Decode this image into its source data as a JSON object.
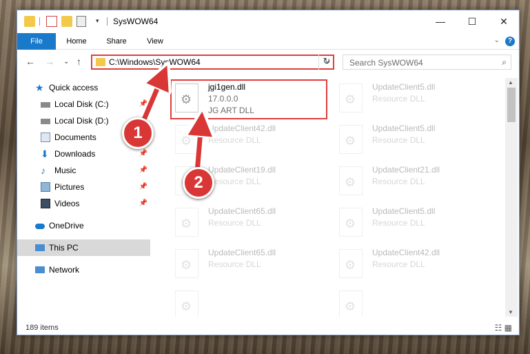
{
  "window": {
    "title": "SysWOW64",
    "controls": {
      "minimize": "—",
      "maximize": "☐",
      "close": "✕"
    }
  },
  "ribbon": {
    "tabs": [
      "File",
      "Home",
      "Share",
      "View"
    ],
    "help": "?",
    "expand": "⌄"
  },
  "nav": {
    "back": "←",
    "forward": "→",
    "recent": "⌄",
    "up": "↑",
    "address": "C:\\Windows\\SysWOW64",
    "refresh": "↻",
    "search_placeholder": "Search SysWOW64"
  },
  "sidebar": {
    "items": [
      {
        "label": "Quick access",
        "icon": "star-icon",
        "pinned": false
      },
      {
        "label": "Local Disk (C:)",
        "icon": "drive-icon",
        "pinned": true
      },
      {
        "label": "Local Disk (D:)",
        "icon": "drive-icon",
        "pinned": true
      },
      {
        "label": "Documents",
        "icon": "documents-icon",
        "pinned": true
      },
      {
        "label": "Downloads",
        "icon": "download-icon",
        "pinned": true
      },
      {
        "label": "Music",
        "icon": "music-icon",
        "pinned": true
      },
      {
        "label": "Pictures",
        "icon": "pictures-icon",
        "pinned": true
      },
      {
        "label": "Videos",
        "icon": "videos-icon",
        "pinned": true
      },
      {
        "label": "OneDrive",
        "icon": "cloud-icon",
        "pinned": false
      },
      {
        "label": "This PC",
        "icon": "computer-icon",
        "pinned": false
      },
      {
        "label": "Network",
        "icon": "network-icon",
        "pinned": false
      }
    ]
  },
  "files": [
    {
      "name": "jgi1gen.dll",
      "line2": "17.0.0.0",
      "line3": "JG ART DLL",
      "faded": false
    },
    {
      "name": "UpdateClient5.dll",
      "line2": "Resource DLL",
      "line3": "",
      "faded": true
    },
    {
      "name": "UpdateClient42.dll",
      "line2": "Resource DLL",
      "line3": "",
      "faded": true
    },
    {
      "name": "UpdateClient5.dll",
      "line2": "Resource DLL",
      "line3": "",
      "faded": true
    },
    {
      "name": "UpdateClient19.dll",
      "line2": "Resource DLL",
      "line3": "",
      "faded": true
    },
    {
      "name": "UpdateClient21.dll",
      "line2": "Resource DLL",
      "line3": "",
      "faded": true
    },
    {
      "name": "UpdateClient65.dll",
      "line2": "Resource DLL",
      "line3": "",
      "faded": true
    },
    {
      "name": "UpdateClient5.dll",
      "line2": "Resource DLL",
      "line3": "",
      "faded": true
    },
    {
      "name": "UpdateClient65.dll",
      "line2": "Resource DLL",
      "line3": "",
      "faded": true
    },
    {
      "name": "UpdateClient42.dll",
      "line2": "Resource DLL",
      "line3": "",
      "faded": true
    }
  ],
  "status": {
    "items_count": "189 items"
  },
  "annotations": {
    "step1": "1",
    "step2": "2",
    "color": "#d93636"
  }
}
